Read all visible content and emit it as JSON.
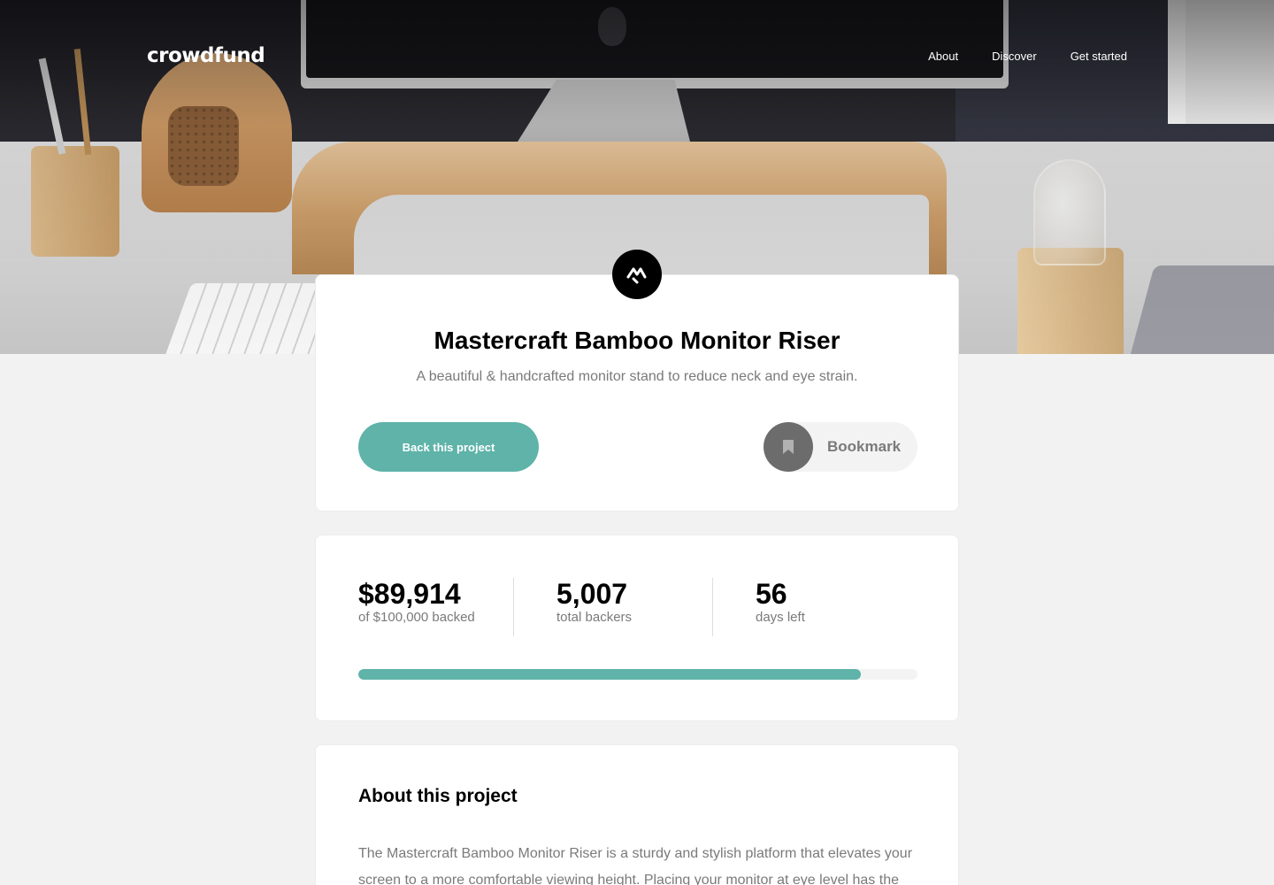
{
  "header": {
    "logo": "crowdfund",
    "nav": [
      "About",
      "Discover",
      "Get started"
    ]
  },
  "project": {
    "logo_icon": "mastercraft-logo-icon",
    "title": "Mastercraft Bamboo Monitor Riser",
    "description": "A beautiful & handcrafted monitor stand to reduce neck and eye strain.",
    "back_label": "Back this project",
    "bookmark_label": "Bookmark",
    "bookmark_icon": "bookmark-icon"
  },
  "stats": {
    "backed_value": "$89,914",
    "backed_label": "of $100,000 backed",
    "backers_value": "5,007",
    "backers_label": "total backers",
    "days_value": "56",
    "days_label": "days left",
    "progress_fraction": 0.8991
  },
  "about": {
    "title": "About this project",
    "text": "The Mastercraft Bamboo Monitor Riser is a sturdy and stylish platform that elevates your screen to a more comfortable viewing height. Placing your monitor at eye level has the"
  },
  "colors": {
    "accent": "#5fb3a9",
    "dark_accent": "#000000",
    "muted_text": "#7a7a7a",
    "background": "#f2f2f2"
  }
}
